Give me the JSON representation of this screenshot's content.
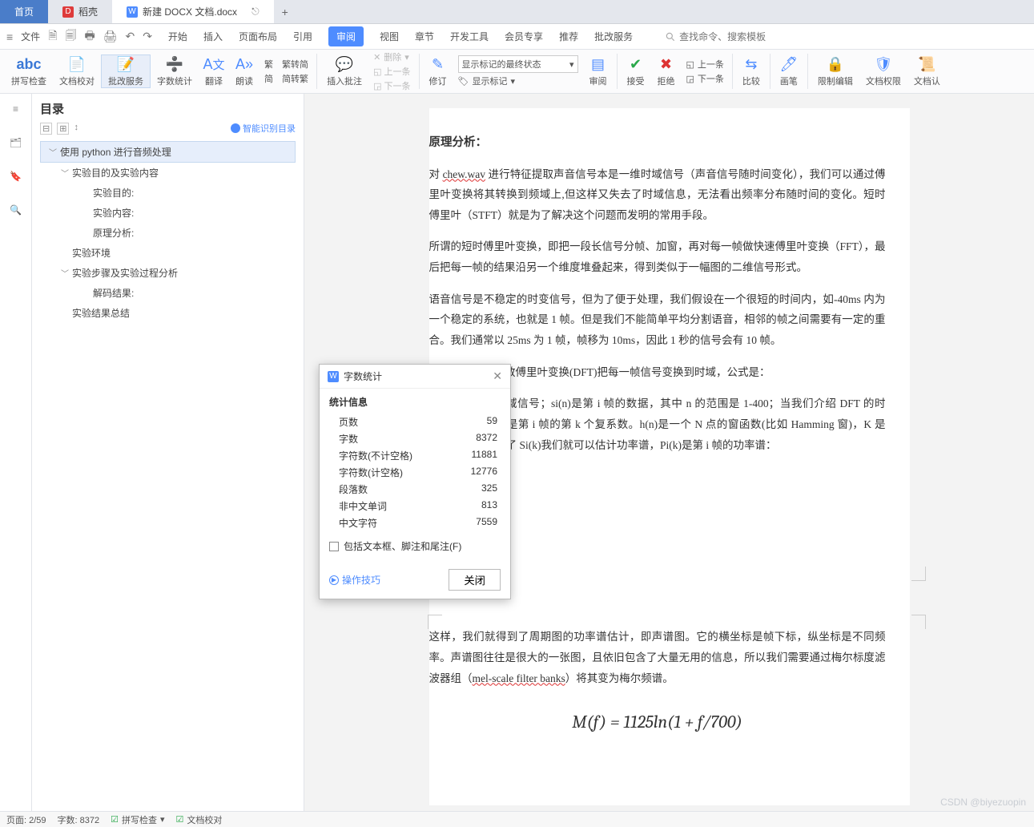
{
  "tabs": {
    "home": "首页",
    "dao": "稻壳",
    "doc": "新建 DOCX 文档.docx",
    "add": "+"
  },
  "menu": {
    "file": "文件",
    "items": [
      "开始",
      "插入",
      "页面布局",
      "引用",
      "审阅",
      "视图",
      "章节",
      "开发工具",
      "会员专享",
      "推荐",
      "批改服务"
    ],
    "active_index": 4,
    "search_placeholder": "查找命令、搜索模板"
  },
  "ribbon": {
    "spellcheck": "拼写检查",
    "doc_proof": "文档校对",
    "review_service": "批改服务",
    "word_count": "字数统计",
    "translate": "翻译",
    "read_aloud": "朗读",
    "trad_simp": "繁转简",
    "simp_trad": "简转繁",
    "conv_group_a": "繁",
    "conv_group_b": "简",
    "insert_comment": "插入批注",
    "delete": "删除",
    "prev_item": "上一条",
    "next_item": "下一条",
    "edit": "修订",
    "show_final": "显示标记的最终状态",
    "show_marks": "显示标记",
    "review_pane": "审阅",
    "accept": "接受",
    "reject": "拒绝",
    "prev_change": "上一条",
    "next_change": "下一条",
    "compare": "比较",
    "pen": "画笔",
    "restrict": "限制编辑",
    "doc_perm": "文档权限",
    "doc_lk": "文档认"
  },
  "toc": {
    "title": "目录",
    "smart": "智能识别目录",
    "items": [
      {
        "level": 1,
        "text": "使用 python 进行音频处理",
        "exp": true,
        "root": true
      },
      {
        "level": 2,
        "text": "实验目的及实验内容",
        "exp": true
      },
      {
        "level": 3,
        "text": "实验目的:"
      },
      {
        "level": 3,
        "text": "实验内容:"
      },
      {
        "level": 3,
        "text": "原理分析:"
      },
      {
        "level": 2,
        "text": "实验环境"
      },
      {
        "level": 2,
        "text": "实验步骤及实验过程分析",
        "exp": true
      },
      {
        "level": 3,
        "text": "解码结果:"
      },
      {
        "level": 2,
        "text": "实验结果总结"
      }
    ]
  },
  "dialog": {
    "title": "字数统计",
    "subtitle": "统计信息",
    "rows": [
      {
        "label": "页数",
        "value": "59"
      },
      {
        "label": "字数",
        "value": "8372"
      },
      {
        "label": "字符数(不计空格)",
        "value": "11881"
      },
      {
        "label": "字符数(计空格)",
        "value": "12776"
      },
      {
        "label": "段落数",
        "value": "325"
      },
      {
        "label": "非中文单词",
        "value": "813"
      },
      {
        "label": "中文字符",
        "value": "7559"
      }
    ],
    "checkbox": "包括文本框、脚注和尾注(F)",
    "tip": "操作技巧",
    "close": "关闭"
  },
  "doc": {
    "heading": "原理分析：",
    "p1a": "对 ",
    "p1b": "chew.wav",
    "p1c": " 进行特征提取声音信号本是一维时域信号（声音信号随时间变化），我们可以通过傅里叶变换将其转换到频域上,但这样又失去了时域信息，无法看出频率分布随时间的变化。短时傅里叶（STFT）就是为了解决这个问题而发明的常用手段。",
    "p2": "所谓的短时傅里叶变换，即把一段长信号分帧、加窗，再对每一帧做快速傅里叶变换（FFT），最后把每一帧的结果沿另一个维度堆叠起来，得到类似于一幅图的二维信号形式。",
    "p3": "语音信号是不稳定的时变信号，但为了便于处理，我们假设在一个很短的时间内，如-40ms 内为一个稳定的系统，也就是 1 帧。但是我们不能简单平均分割语音，相邻的帧之间需要有一定的重合。我们通常以 25ms 为 1 帧，帧移为 10ms，因此 1 秒的信号会有 10 帧。",
    "p4": "我们可以使用离散傅里叶变换(DFT)把每一帧信号变换到时域，公式是：",
    "p5": "其中 s(n)表示时域信号；si(n)是第 i 帧的数据，其中 n 的范围是 1-400；当我们介绍 DFT 的时候，Si(k)表示的是第 i 帧的第 k 个复系数。h(n)是一个 N 点的窗函数(比如 Hamming 窗)，K 是 DFT 的长度。有了 Si(k)我们就可以估计功率谱，Pi(k)是第 i 帧的功率谱：",
    "p6a": "这样，我们就得到了周期图的功率谱估计，即声谱图。它的横坐标是帧下标，纵坐标是不同频率。声谱图往往是很大的一张图，且依旧包含了大量无用的信息，所以我们需要通过梅尔标度滤波器组（",
    "p6b": "mel-scale filter banks",
    "p6c": "）将其变为梅尔频谱。",
    "formula": "M(f) = 1125ln(1 + f/700)"
  },
  "status": {
    "page": "页面: 2/59",
    "words": "字数: 8372",
    "spell": "拼写检查",
    "proof": "文档校对"
  },
  "watermark": "CSDN @biyezuopin"
}
